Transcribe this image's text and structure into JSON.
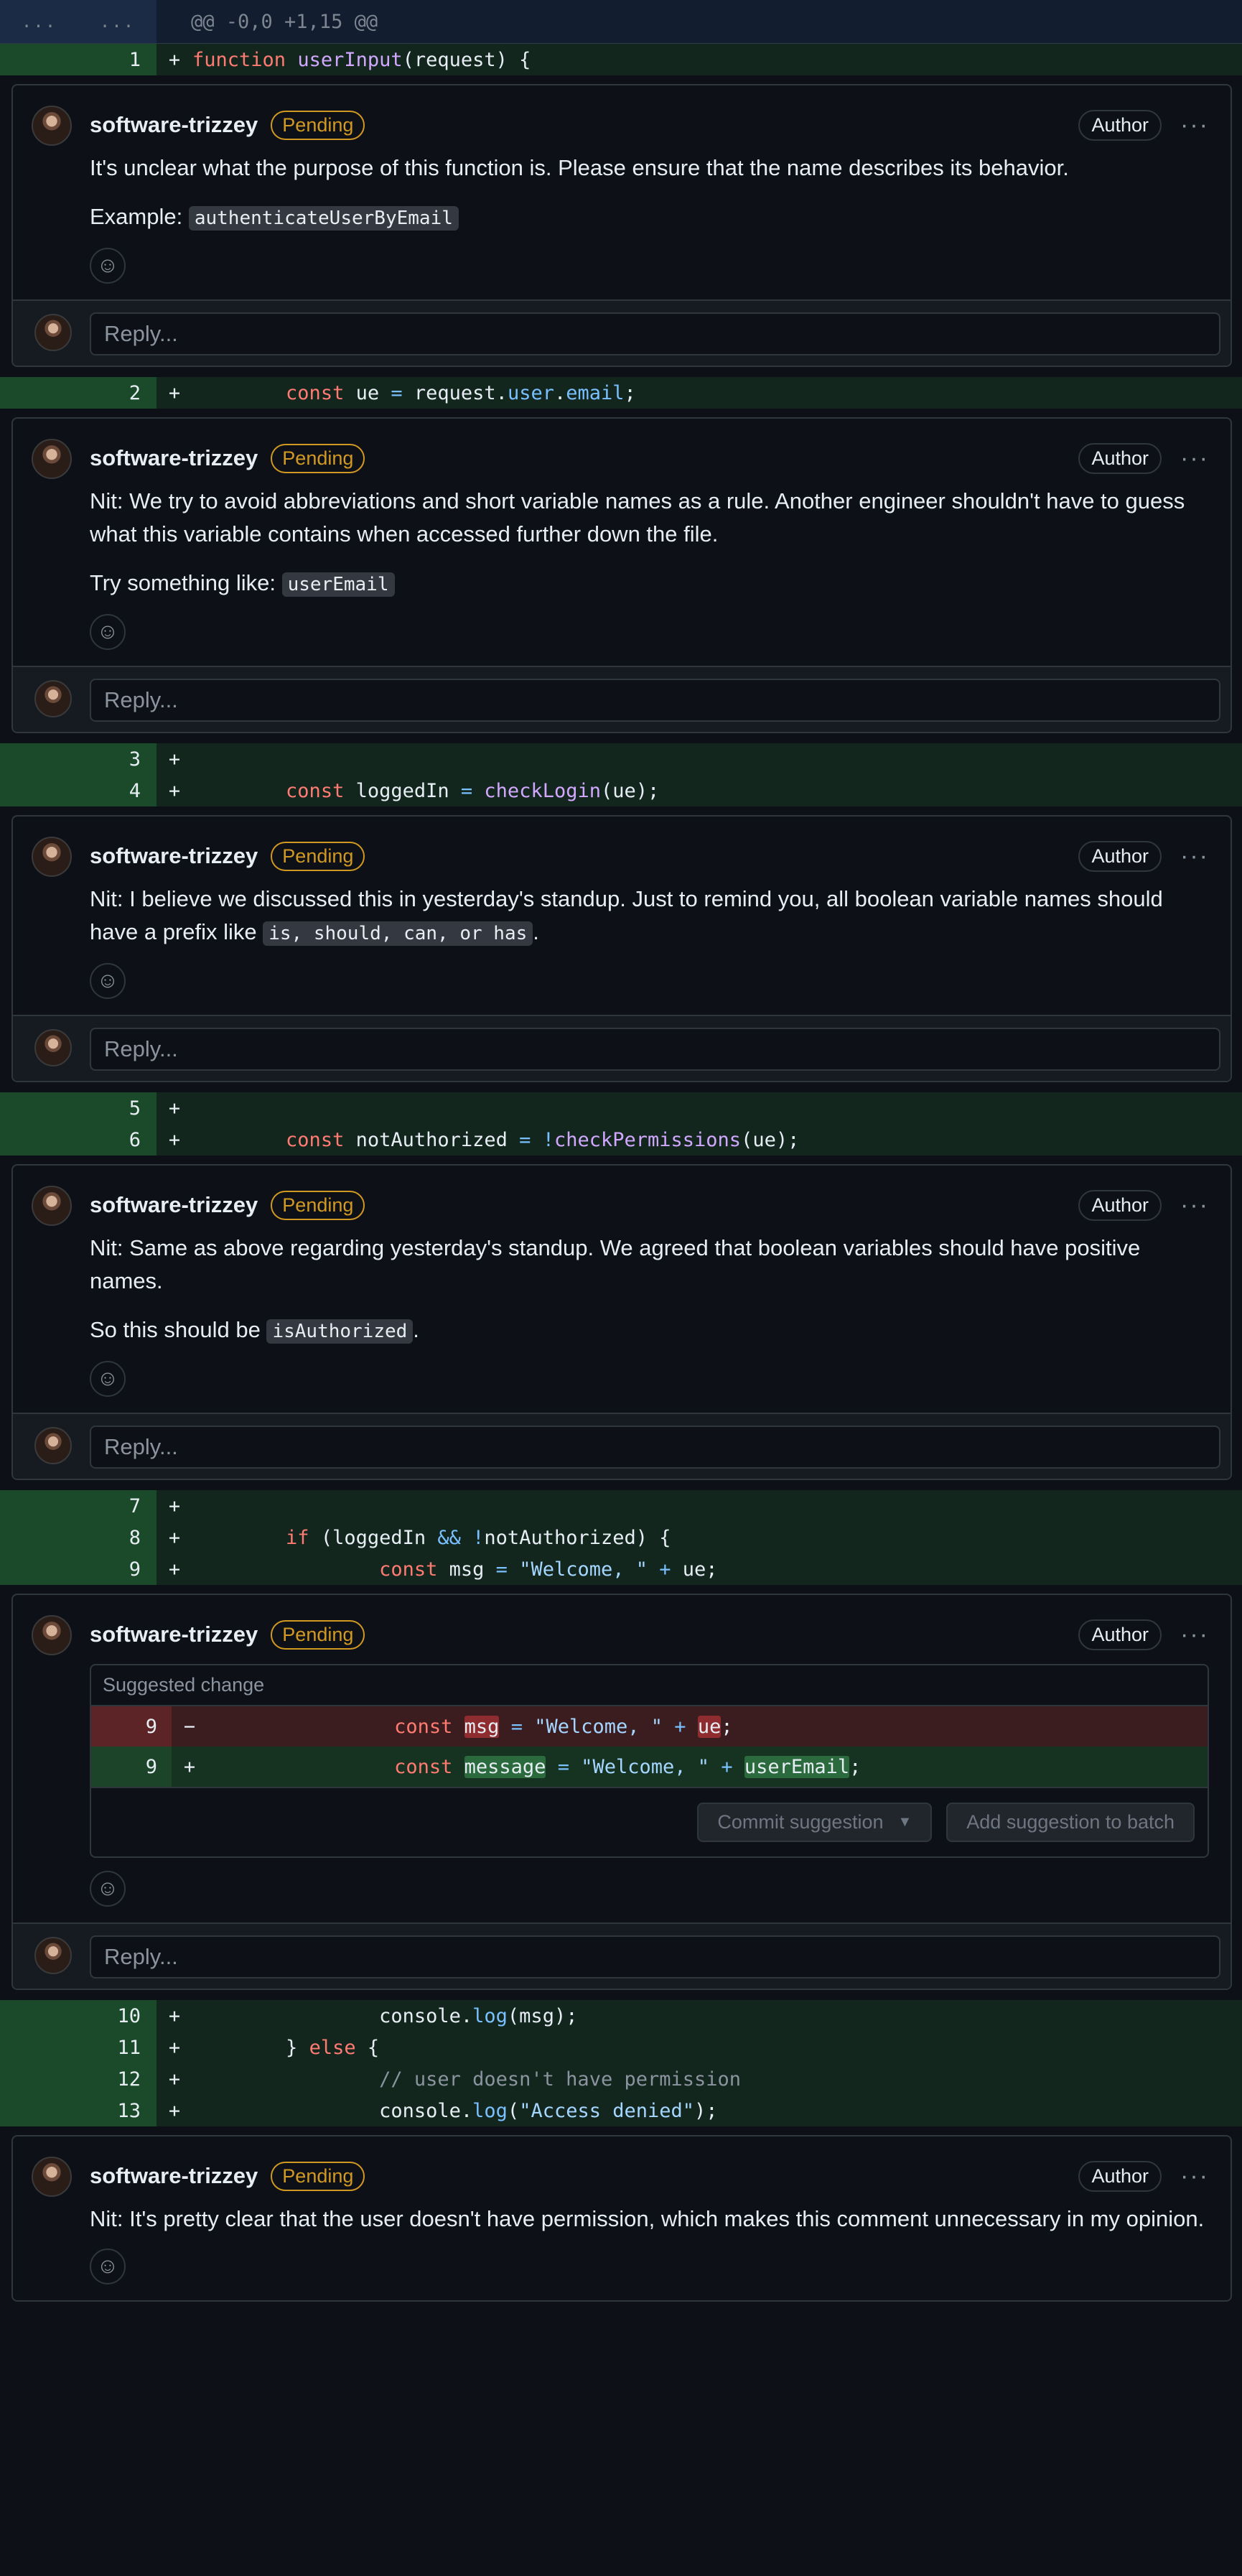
{
  "hunk": {
    "gutter_left": "...",
    "gutter_right": "...",
    "header": "@@ -0,0 +1,15 @@"
  },
  "lines": {
    "l1": {
      "num": "1"
    },
    "l2": {
      "num": "2"
    },
    "l3": {
      "num": "3"
    },
    "l4": {
      "num": "4"
    },
    "l5": {
      "num": "5"
    },
    "l6": {
      "num": "6"
    },
    "l7": {
      "num": "7"
    },
    "l8": {
      "num": "8"
    },
    "l9": {
      "num": "9"
    },
    "l10": {
      "num": "10"
    },
    "l11": {
      "num": "11"
    },
    "l12": {
      "num": "12"
    },
    "l13": {
      "num": "13"
    }
  },
  "common": {
    "username": "software-trizzey",
    "pending": "Pending",
    "author": "Author",
    "kebab": "···",
    "reply_placeholder": "Reply...",
    "sign_add": "+",
    "sign_del": "−"
  },
  "comments": [
    {
      "p1": "It's unclear what the purpose of this function is. Please ensure that the name describes its behavior.",
      "p2_prefix": "Example: ",
      "p2_code": "authenticateUserByEmail"
    },
    {
      "p1": "Nit: We try to avoid abbreviations and short variable names as a rule. Another engineer shouldn't have to guess what this variable contains when accessed further down the file.",
      "p2_prefix": "Try something like: ",
      "p2_code": "userEmail"
    },
    {
      "p1_prefix": "Nit: I believe we discussed this in yesterday's standup. Just to remind you, all boolean variable names should have a prefix like ",
      "p1_code": "is, should, can, or has",
      "p1_suffix": "."
    },
    {
      "p1": "Nit: Same as above regarding yesterday's standup. We agreed that boolean variables should have positive names.",
      "p2_prefix": "So this should be ",
      "p2_code": "isAuthorized",
      "p2_suffix": "."
    },
    {
      "suggestion_title": "Suggested change",
      "del_num": "9",
      "add_num": "9",
      "commit_button": "Commit suggestion",
      "batch_button": "Add suggestion to batch"
    },
    {
      "p1": "Nit: It's pretty clear that the user doesn't have permission, which makes this comment unnecessary in my opinion."
    }
  ],
  "colors": {
    "background": "#0d1117",
    "added_line": "#12261e",
    "added_gutter": "#1a4a29",
    "pending_badge": "#d29922"
  },
  "icons": [
    "smiley-icon",
    "kebab-menu-icon",
    "chevron-down-icon",
    "avatar"
  ]
}
